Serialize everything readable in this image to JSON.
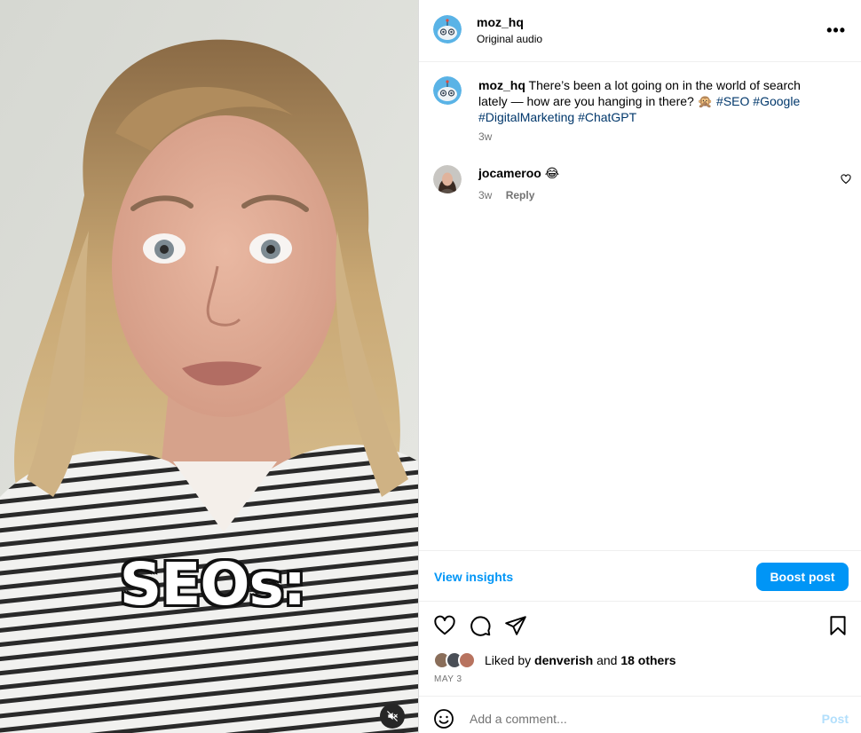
{
  "post": {
    "username": "moz_hq",
    "audio": "Original audio",
    "more_icon": "more-horizontal-icon",
    "video_overlay_text": "SEOs:",
    "mute_icon": "volume-muted-icon",
    "caption": {
      "username": "moz_hq",
      "text": "There’s been a lot going on in the world of search lately — how are you hanging in there?",
      "emoji": "🙊",
      "hashtags": [
        "#SEO",
        "#Google",
        "#DigitalMarketing",
        "#ChatGPT"
      ],
      "time": "3w"
    },
    "comments": [
      {
        "username": "jocameroo",
        "text": "😂",
        "time": "3w",
        "reply_label": "Reply"
      }
    ],
    "view_insights_label": "View insights",
    "boost_label": "Boost post",
    "likes": {
      "prefix": "Liked by",
      "user": "denverish",
      "joiner": "and",
      "others": "18 others"
    },
    "date": "MAY 3",
    "comment_box": {
      "placeholder": "Add a comment...",
      "post_label": "Post"
    }
  },
  "colors": {
    "accent": "#0095f6",
    "hashtag": "#00376b",
    "muted_text": "#737373",
    "post_disabled": "#b2dffc"
  }
}
